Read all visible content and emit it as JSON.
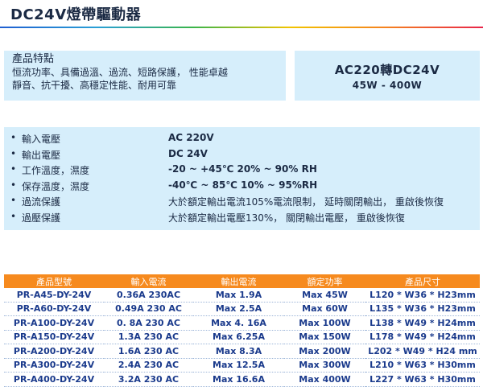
{
  "title": "DC24V燈帶驅動器",
  "features": {
    "heading": "產品特點",
    "line1": "恒流功率、具備過溫、過流、短路保護， 性能卓越",
    "line2": "靜音、抗干擾、高穩定性能、耐用可靠"
  },
  "ac_box": {
    "main": "AC220轉DC24V",
    "sub": "45W - 400W"
  },
  "specs": [
    {
      "label": "輸入電壓",
      "value": "AC 220V",
      "bold": true
    },
    {
      "label": "輸出電壓",
      "value": "DC 24V",
      "bold": true
    },
    {
      "label": "工作溫度，濕度",
      "value": "-20 ~ +45℃ 20% ~ 90% RH",
      "bold": true
    },
    {
      "label": "保存溫度，濕度",
      "value": "-40℃ ~ 85℃ 10% ~ 95%RH",
      "bold": true
    },
    {
      "label": "過流保護",
      "value": "大於額定輸出電流105%電流限制， 延時關閉輸出， 重啟後恢復",
      "bold": false
    },
    {
      "label": "過壓保護",
      "value": "大於額定輸出電壓130%， 關閉輸出電壓， 重啟後恢復",
      "bold": false
    }
  ],
  "table": {
    "headers": [
      "產品型號",
      "輸入電流",
      "輸出電流",
      "額定功率",
      "產品尺寸"
    ],
    "rows": [
      [
        "PR-A45-DY-24V",
        "0.36A 230AC",
        "Max 1.9A",
        "Max 45W",
        "L120 * W36 * H23mm"
      ],
      [
        "PR-A60-DY-24V",
        "0.49A 230 AC",
        "Max 2.5A",
        "Max 60W",
        "L135 * W36 * H23mm"
      ],
      [
        "PR-A100-DY-24V",
        "0. 8A 230 AC",
        "Max 4. 16A",
        "Max 100W",
        "L138 * W49 * H24mm"
      ],
      [
        "PR-A150-DY-24V",
        "1.3A 230 AC",
        "Max 6.25A",
        "Max 150W",
        "L178 * W49 * H24mm"
      ],
      [
        "PR-A200-DY-24V",
        "1.6A 230 AC",
        "Max 8.3A",
        "Max 200W",
        "L202 * W49 * H24 mm"
      ],
      [
        "PR-A300-DY-24V",
        "2.4A 230 AC",
        "Max 12.5A",
        "Max 300W",
        "L210 * W63 * H30mm"
      ],
      [
        "PR-A400-DY-24V",
        "3.2A 230 AC",
        "Max 16.6A",
        "Max 400W",
        "L227 * W63 * H30mm"
      ]
    ]
  }
}
